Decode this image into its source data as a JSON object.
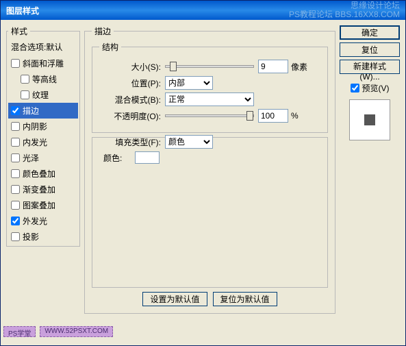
{
  "titlebar": {
    "title": "图层样式",
    "watermark1": "思缘设计论坛",
    "watermark2": "PS教程论坛 BBS.16XX8.COM"
  },
  "styles_panel": {
    "legend": "样式",
    "blend_default": "混合选项:默认",
    "items": [
      {
        "label": "斜面和浮雕",
        "checked": false,
        "indent": false
      },
      {
        "label": "等高线",
        "checked": false,
        "indent": true
      },
      {
        "label": "纹理",
        "checked": false,
        "indent": true
      },
      {
        "label": "描边",
        "checked": true,
        "indent": false,
        "selected": true
      },
      {
        "label": "内阴影",
        "checked": false,
        "indent": false
      },
      {
        "label": "内发光",
        "checked": false,
        "indent": false
      },
      {
        "label": "光泽",
        "checked": false,
        "indent": false
      },
      {
        "label": "颜色叠加",
        "checked": false,
        "indent": false
      },
      {
        "label": "渐变叠加",
        "checked": false,
        "indent": false
      },
      {
        "label": "图案叠加",
        "checked": false,
        "indent": false
      },
      {
        "label": "外发光",
        "checked": true,
        "indent": false
      },
      {
        "label": "投影",
        "checked": false,
        "indent": false
      }
    ]
  },
  "stroke": {
    "legend": "描边",
    "structure_legend": "结构",
    "size_label": "大小(S):",
    "size_value": "9",
    "size_unit": "像素",
    "position_label": "位置(P):",
    "position_value": "内部",
    "blendmode_label": "混合模式(B):",
    "blendmode_value": "正常",
    "opacity_label": "不透明度(O):",
    "opacity_value": "100",
    "opacity_unit": "%",
    "filltype_label": "填充类型(F):",
    "filltype_value": "颜色",
    "color_label": "颜色:",
    "set_default": "设置为默认值",
    "reset_default": "复位为默认值"
  },
  "right": {
    "ok": "确定",
    "cancel": "复位",
    "new_style": "新建样式(W)...",
    "preview_label": "预览(V)",
    "preview_checked": true
  },
  "footer": {
    "tag1": "PS学堂",
    "tag2": "WWW.52PSXT.COM"
  }
}
